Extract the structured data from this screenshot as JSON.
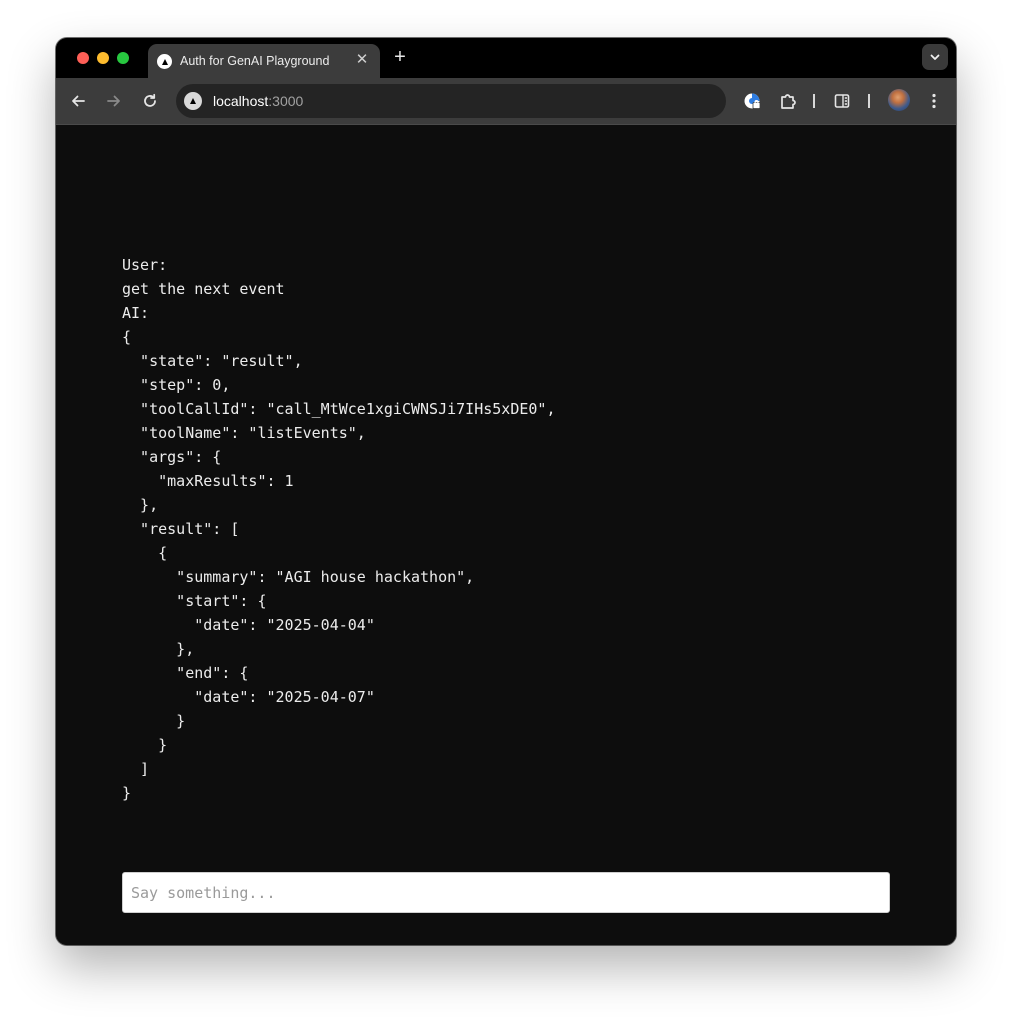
{
  "browser": {
    "tab": {
      "title": "Auth for GenAI Playground"
    },
    "address": {
      "host": "localhost",
      "port": ":3000"
    }
  },
  "chat": {
    "user_label": "User:",
    "user_message": "get the next event",
    "ai_label": "AI:",
    "ai_response": "{\n  \"state\": \"result\",\n  \"step\": 0,\n  \"toolCallId\": \"call_MtWce1xgiCWNSJi7IHs5xDE0\",\n  \"toolName\": \"listEvents\",\n  \"args\": {\n    \"maxResults\": 1\n  },\n  \"result\": [\n    {\n      \"summary\": \"AGI house hackathon\",\n      \"start\": {\n        \"date\": \"2025-04-04\"\n      },\n      \"end\": {\n        \"date\": \"2025-04-07\"\n      }\n    }\n  ]\n}",
    "input": {
      "placeholder": "Say something...",
      "value": ""
    }
  },
  "icons": {
    "tab_favicon": "triangle-logo-icon",
    "tab_close": "close-icon",
    "new_tab": "plus-icon",
    "tab_search": "chevron-down-icon",
    "back": "arrow-left-icon",
    "forward": "arrow-right-icon",
    "reload": "reload-icon",
    "site_info": "triangle-logo-icon",
    "password_manager": "key-icon",
    "extensions": "puzzle-icon",
    "side_panel": "side-panel-icon",
    "profile": "avatar",
    "menu": "kebab-menu-icon"
  },
  "colors": {
    "page_background": "#0d0d0d",
    "text": "#ececec",
    "tab_active": "#3c3c3c",
    "tab_strip": "#000000",
    "input_background": "#ffffff"
  }
}
